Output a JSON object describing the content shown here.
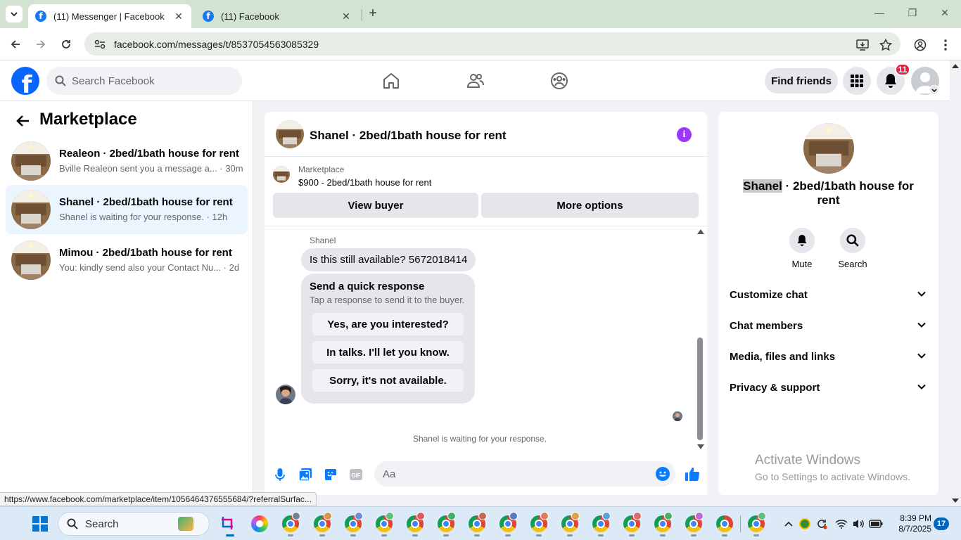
{
  "browser": {
    "tabs": [
      {
        "title": "(11) Messenger | Facebook",
        "active": true
      },
      {
        "title": "(11) Facebook",
        "active": false
      }
    ],
    "url": "facebook.com/messages/t/8537054563085329",
    "status_url": "https://www.facebook.com/marketplace/item/1056464376555684/?referralSurfac..."
  },
  "header": {
    "search_placeholder": "Search Facebook",
    "find_friends": "Find friends",
    "notification_count": "11",
    "brand_color": "#0866ff"
  },
  "sidebar": {
    "title": "Marketplace",
    "conversations": [
      {
        "title": "Realeon · 2bed/1bath house for rent",
        "preview": "Bville Realeon sent you a message a...",
        "time": "· 30m",
        "selected": false
      },
      {
        "title": "Shanel · 2bed/1bath house for rent",
        "preview": "Shanel is waiting for your response.",
        "time": "· 12h",
        "selected": true
      },
      {
        "title": "Mimou · 2bed/1bath house for rent",
        "preview": "You: kindly send also your Contact Nu...",
        "time": "· 2d",
        "selected": false
      }
    ]
  },
  "chat": {
    "title": "Shanel · 2bed/1bath house for rent",
    "listing_category": "Marketplace",
    "listing_title": "$900 - 2bed/1bath house for rent",
    "view_buyer": "View buyer",
    "more_options": "More options",
    "sender": "Shanel",
    "message": "Is this still available? 5672018414",
    "quick_title": "Send a quick response",
    "quick_subtitle": "Tap a response to send it to the buyer.",
    "quick_options": [
      "Yes, are you interested?",
      "In talks. I'll let you know.",
      "Sorry, it's not available."
    ],
    "waiting": "Shanel is waiting for your response.",
    "composer_placeholder": "Aa"
  },
  "details": {
    "title_name": "Shanel",
    "title_rest": " · 2bed/1bath house for rent",
    "mute": "Mute",
    "search": "Search",
    "sections": [
      "Customize chat",
      "Chat members",
      "Media, files and links",
      "Privacy & support"
    ]
  },
  "watermark": {
    "line1": "Activate Windows",
    "line2": "Go to Settings to activate Windows."
  },
  "taskbar": {
    "search": "Search",
    "time": "8:39 PM",
    "date": "8/7/2025",
    "notifications": "17"
  }
}
